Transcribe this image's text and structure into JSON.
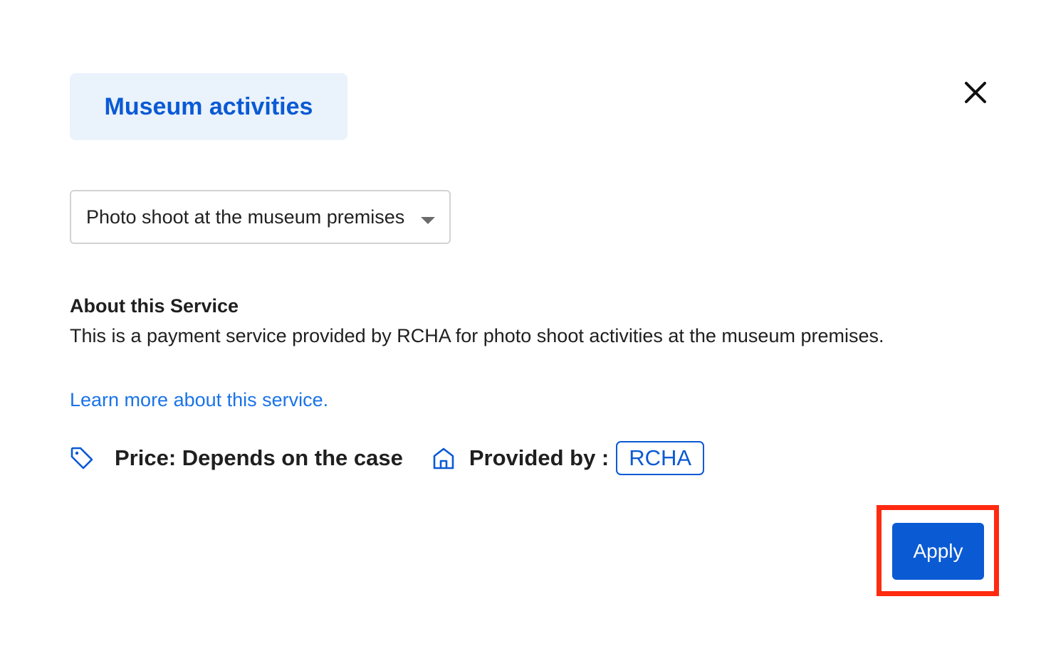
{
  "header": {
    "category_label": "Museum activities",
    "close_icon": "close-icon"
  },
  "service_select": {
    "selected_value": "Photo shoot at the museum premises",
    "arrow_icon": "caret-down-icon"
  },
  "about": {
    "heading": "About this Service",
    "description": "This is a payment service provided by RCHA for photo shoot activities at the museum premises."
  },
  "learn_more": {
    "label": "Learn more about this service."
  },
  "meta": {
    "price_icon": "tag-icon",
    "price_label": "Price: Depends on the case",
    "provider_icon": "home-icon",
    "provider_label": "Provided by :",
    "provider_name": "RCHA"
  },
  "actions": {
    "apply_label": "Apply"
  },
  "colors": {
    "accent": "#0a5ad4",
    "link": "#1a73e8",
    "chip_background": "#eaf2fc",
    "highlight": "#ff2a10"
  }
}
